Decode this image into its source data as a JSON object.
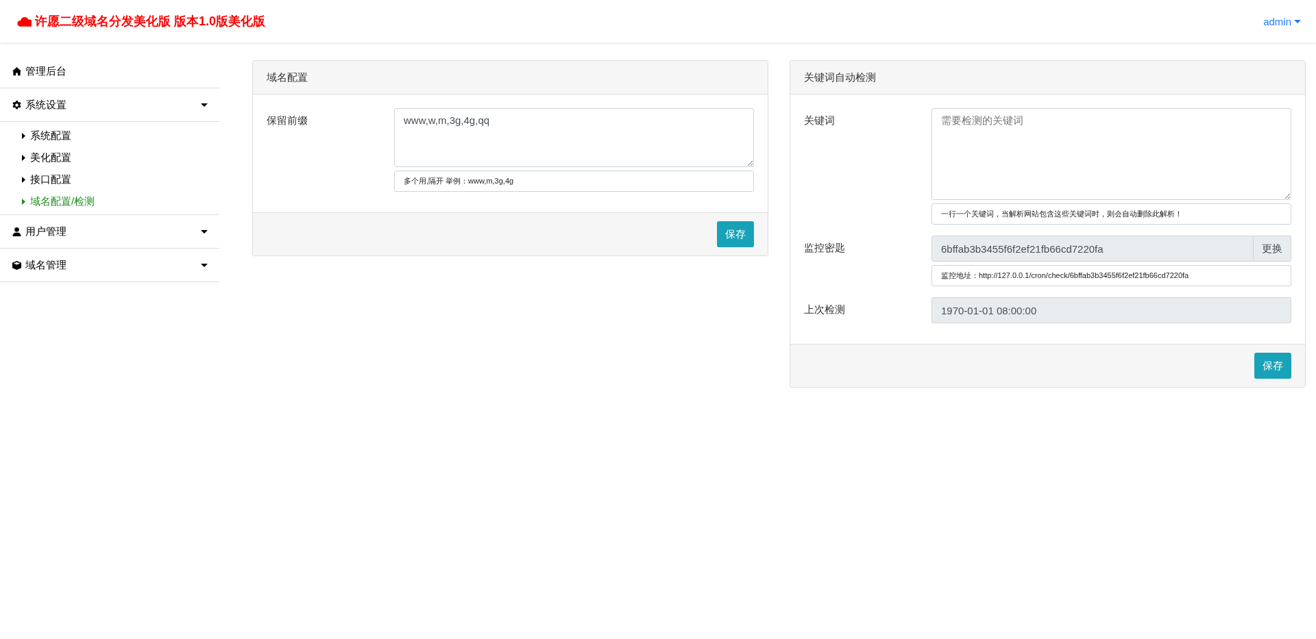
{
  "header": {
    "brand": "许愿二级域名分发美化版 版本1.0版美化版",
    "user_menu": "admin"
  },
  "sidebar": {
    "items": [
      {
        "kind": "link",
        "label": "管理后台"
      },
      {
        "kind": "group",
        "label": "系统设置",
        "children": [
          {
            "label": "系统配置",
            "selected": false
          },
          {
            "label": "美化配置",
            "selected": false
          },
          {
            "label": "接口配置",
            "selected": false
          },
          {
            "label": "域名配置/检测",
            "selected": true
          }
        ]
      },
      {
        "kind": "group",
        "label": "用户管理"
      },
      {
        "kind": "group",
        "label": "域名管理"
      }
    ]
  },
  "panels": [
    {
      "title": "域名配置",
      "fields": [
        {
          "kind": "textarea",
          "label": "保留前缀",
          "value": "www,w,m,3g,4g,qq",
          "help": "多个用,隔开 举例：www,m,3g,4g"
        }
      ],
      "button": "保存"
    },
    {
      "title": "关键词自动检测",
      "fields": [
        {
          "kind": "textarea",
          "label": "关键词",
          "placeholder": "需要检测的关键词",
          "help": "一行一个关键词，当解析网站包含这些关键词时，则会自动删除此解析！"
        },
        {
          "kind": "input-group",
          "label": "监控密匙",
          "value": "6bffab3b3455f6f2ef21fb66cd7220fa",
          "addon": "更换",
          "help": "监控地址：http://127.0.0.1/cron/check/6bffab3b3455f6f2ef21fb66cd7220fa"
        },
        {
          "kind": "readonly",
          "label": "上次检测",
          "value": "1970-01-01 08:00:00"
        }
      ],
      "button": "保存"
    }
  ]
}
